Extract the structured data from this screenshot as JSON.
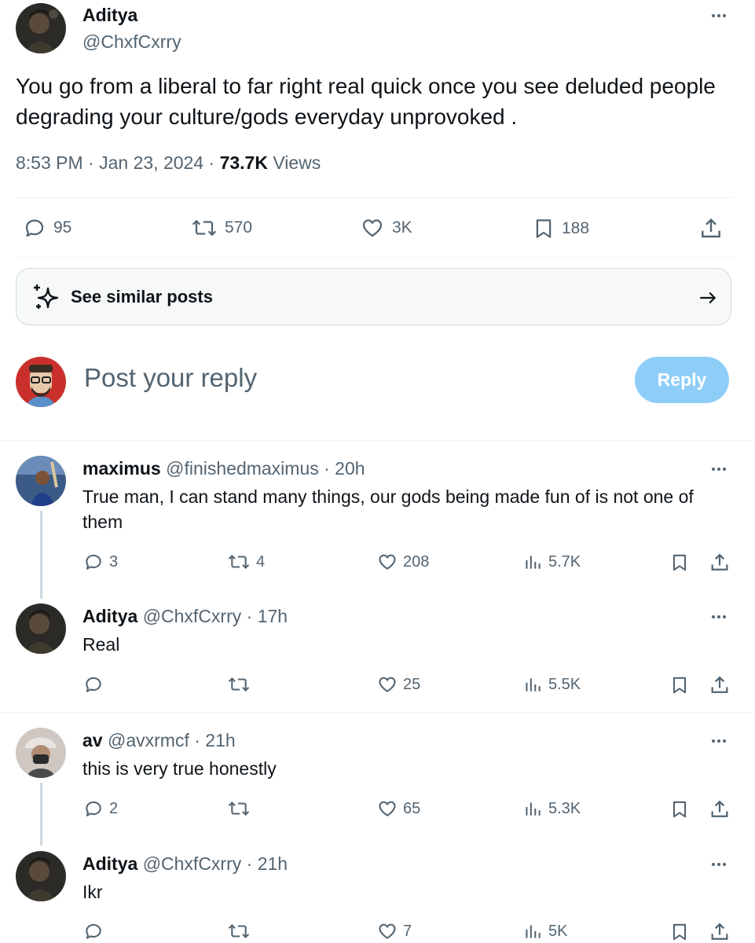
{
  "main_tweet": {
    "author_name": "Aditya",
    "author_handle": "@ChxfCxrry",
    "text": "You go from a liberal to far right real quick once you see deluded people degrading your culture/gods everyday unprovoked .",
    "time": "8:53 PM",
    "sep1": " · ",
    "date": "Jan 23, 2024",
    "sep2": " · ",
    "views": "73.7K",
    "views_label": " Views",
    "stats": {
      "replies": "95",
      "reposts": "570",
      "likes": "3K",
      "bookmarks": "188"
    }
  },
  "see_similar": {
    "label": "See similar posts"
  },
  "composer": {
    "placeholder": "Post your reply",
    "reply_button": "Reply"
  },
  "replies": [
    {
      "name": "maximus",
      "handle": "@finishedmaximus · 20h",
      "text": "True man, I can stand many things, our gods being made fun of is not one of them",
      "replies": "3",
      "reposts": "4",
      "likes": "208",
      "views": "5.7K"
    },
    {
      "name": "Aditya",
      "handle": "@ChxfCxrry · 17h",
      "text": "Real",
      "replies": "",
      "reposts": "",
      "likes": "25",
      "views": "5.5K"
    },
    {
      "name": "av",
      "handle": "@avxrmcf · 21h",
      "text": "this is very true honestly",
      "replies": "2",
      "reposts": "",
      "likes": "65",
      "views": "5.3K"
    },
    {
      "name": "Aditya",
      "handle": "@ChxfCxrry · 21h",
      "text": "Ikr",
      "replies": "",
      "reposts": "",
      "likes": "7",
      "views": "5K"
    }
  ],
  "colors": {
    "text_primary": "#0f1419",
    "text_secondary": "#536471",
    "reply_button_disabled": "#8ecdf8",
    "divider": "#eff3f4"
  },
  "icons": [
    "reply-icon",
    "repost-icon",
    "like-icon",
    "bookmark-icon",
    "share-icon",
    "views-icon",
    "sparkle-icon",
    "arrow-right-icon",
    "more-icon"
  ]
}
